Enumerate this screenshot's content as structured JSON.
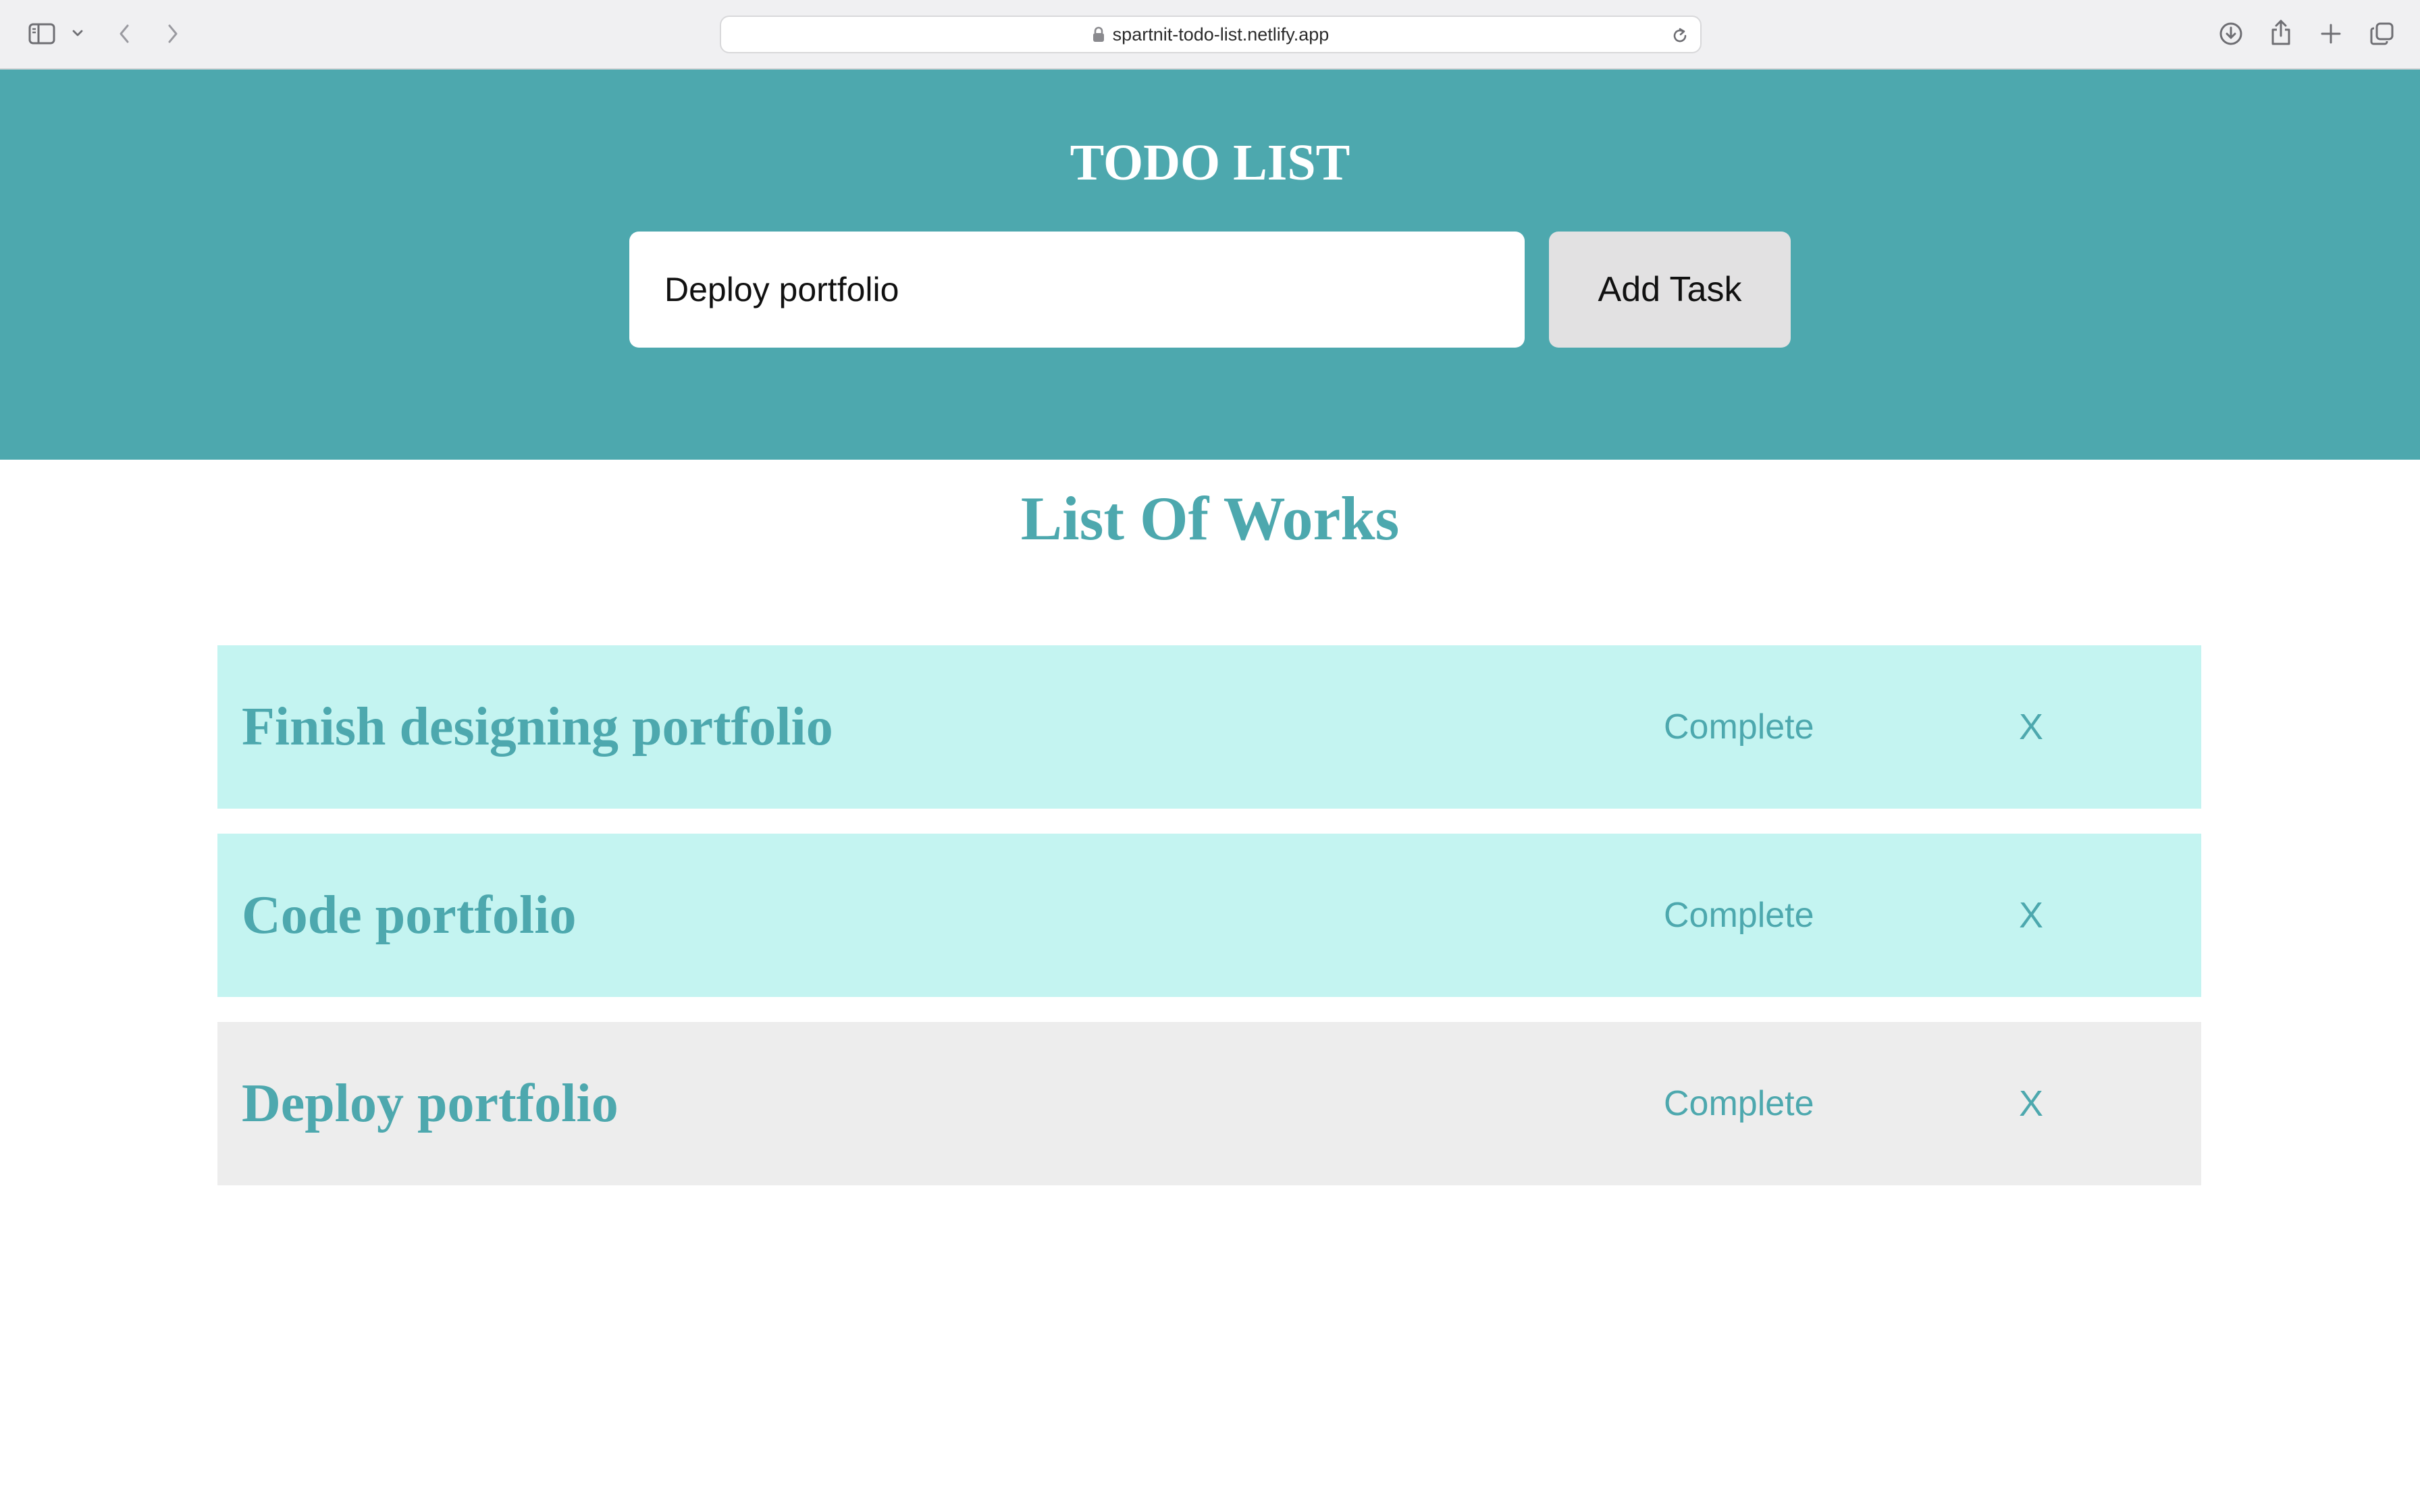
{
  "browser": {
    "url": "spartnit-todo-list.netlify.app",
    "icons": [
      "sidebar-icon",
      "chevron-down-icon",
      "back-icon",
      "forward-icon",
      "lock-icon",
      "reload-icon",
      "download-icon",
      "share-icon",
      "plus-icon",
      "tabs-icon"
    ]
  },
  "header": {
    "title": "TODO LIST",
    "input_value": "Deploy portfolio",
    "add_button_label": "Add Task",
    "background_color": "#4da8ae"
  },
  "list": {
    "title": "List Of Works",
    "tasks": [
      {
        "name": "Finish designing portfolio",
        "complete_label": "Complete",
        "delete_label": "X",
        "row_color": "#c4f4f1"
      },
      {
        "name": "Code portfolio",
        "complete_label": "Complete",
        "delete_label": "X",
        "row_color": "#c4f4f1"
      },
      {
        "name": "Deploy portfolio",
        "complete_label": "Complete",
        "delete_label": "X",
        "row_color": "#ededed"
      }
    ]
  }
}
